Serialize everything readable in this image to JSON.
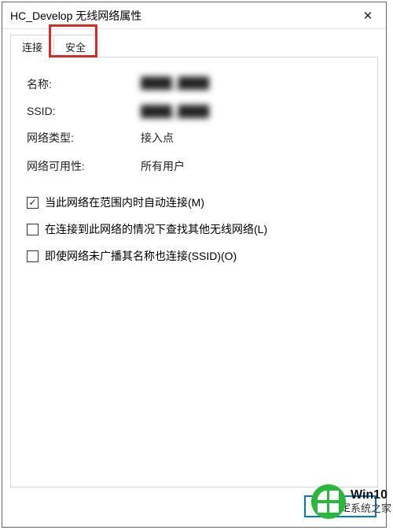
{
  "window": {
    "title": "HC_Develop 无线网络属性",
    "close_glyph": "✕"
  },
  "tabs": {
    "connection": "连接",
    "security": "安全"
  },
  "fields": {
    "name_label": "名称:",
    "name_value": "████_████",
    "ssid_label": "SSID:",
    "ssid_value": "████_████",
    "nettype_label": "网络类型:",
    "nettype_value": "接入点",
    "availability_label": "网络可用性:",
    "availability_value": "所有用户"
  },
  "checkboxes": {
    "auto_connect": "当此网络在范围内时自动连接(M)",
    "find_other": "在连接到此网络的情况下查找其他无线网络(L)",
    "connect_hidden": "即使网络未广播其名称也连接(SSID)(O)"
  },
  "buttons": {
    "ok": "确定"
  },
  "watermark": {
    "line1": "Win10",
    "line2": "系统之家"
  }
}
